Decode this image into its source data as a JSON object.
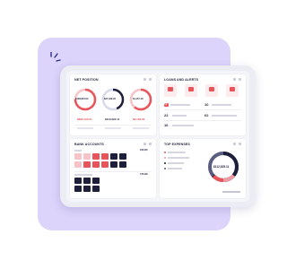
{
  "colors": {
    "accent_red": "#e8545a",
    "navy": "#1d1f3b",
    "lavender": "#dcd4fb",
    "pink": "#f7c3c6"
  },
  "net_position": {
    "title": "NET POSITION",
    "metrics": [
      {
        "value": "$108,804.00",
        "amount": "$889,195.21"
      },
      {
        "value": "$27,439.22",
        "amount": "$110,224.11"
      },
      {
        "value": "$1,157.18",
        "amount": "$6,159.00"
      }
    ]
  },
  "alerts": {
    "title": "LOANS AND ALERTS",
    "rows": [
      {
        "count": "12",
        "color": "#e8545a"
      },
      {
        "count": "10"
      },
      {
        "count": "22"
      },
      {
        "count": "62"
      },
      {
        "count": "16"
      }
    ]
  },
  "bank_accounts": {
    "title": "BANK ACCOUNTS",
    "totals": [
      "166,000",
      "178,228"
    ]
  },
  "top_expenses": {
    "title": "TOP EXPENSES",
    "center_value": "$112,825.11",
    "legend": [
      {
        "color": "#e8545a"
      },
      {
        "color": "#f19aa0"
      },
      {
        "color": "#1d1f3b"
      },
      {
        "color": "#5a5d80"
      }
    ]
  }
}
